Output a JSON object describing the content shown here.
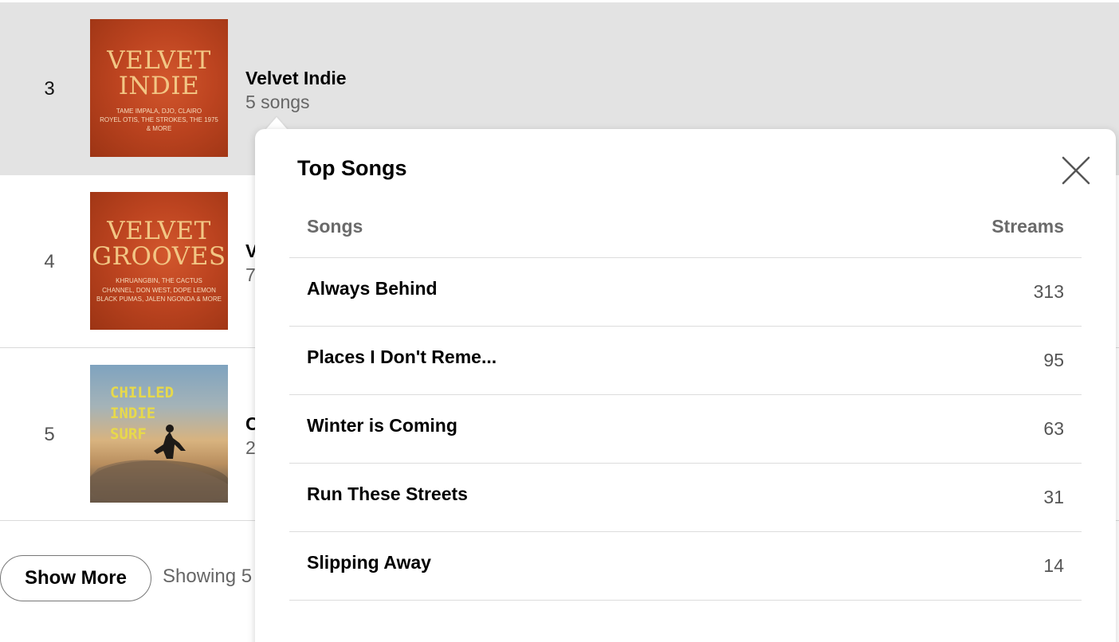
{
  "playlists": [
    {
      "rank": "3",
      "name": "Velvet Indie",
      "count": "5 songs",
      "cover": {
        "title_line1": "VELVET",
        "title_line2": "INDIE",
        "artists_line1": "TAME IMPALA, DJO, CLAIRO",
        "artists_line2": "ROYEL OTIS, THE STROKES, THE 1975",
        "artists_line3": "& MORE"
      }
    },
    {
      "rank": "4",
      "name": "V",
      "count": "7",
      "cover": {
        "title_line1": "VELVET",
        "title_line2": "GROOVES",
        "artists_line1": "KHRUANGBIN, THE CACTUS",
        "artists_line2": "CHANNEL, DON WEST, DOPE LEMON",
        "artists_line3": "BLACK PUMAS, JALEN NGONDA & MORE"
      }
    },
    {
      "rank": "5",
      "name": "C",
      "count": "2",
      "cover": {
        "title_line1": "CHILLED",
        "title_line2": "INDIE",
        "title_line3": "SURF"
      }
    }
  ],
  "footer": {
    "show_more_label": "Show More",
    "showing_text": "Showing 5"
  },
  "popover": {
    "title": "Top Songs",
    "columns": {
      "songs": "Songs",
      "streams": "Streams"
    },
    "songs": [
      {
        "name": "Always Behind",
        "streams": "313"
      },
      {
        "name": "Places I Don't Reme...",
        "streams": "95"
      },
      {
        "name": "Winter is Coming",
        "streams": "63"
      },
      {
        "name": "Run These Streets",
        "streams": "31"
      },
      {
        "name": "Slipping Away",
        "streams": "14"
      }
    ]
  }
}
